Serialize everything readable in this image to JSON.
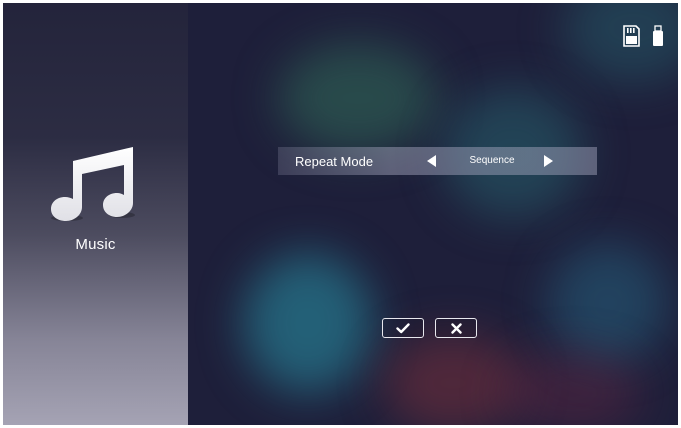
{
  "sidebar": {
    "icon": "music-note-icon",
    "label": "Music"
  },
  "top_icons": [
    {
      "name": "sd-card-icon"
    },
    {
      "name": "usb-drive-icon"
    }
  ],
  "setting": {
    "label": "Repeat Mode",
    "value": "Sequence",
    "prev_icon": "arrow-left-icon",
    "next_icon": "arrow-right-icon"
  },
  "buttons": {
    "confirm_icon": "checkmark-icon",
    "cancel_icon": "x-icon"
  },
  "colors": {
    "background": "#1e1f3a",
    "sidebar_bottom": "#a5a3b4",
    "text": "#ffffff"
  }
}
